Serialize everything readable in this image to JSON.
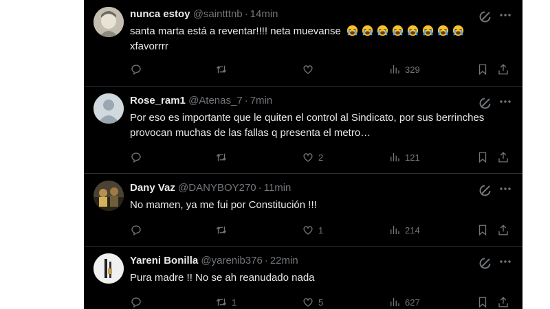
{
  "tweets": [
    {
      "name": "nunca estoy",
      "handle": "@saintttnb",
      "separator": "·",
      "time": "14min",
      "text": "santa marta está a reventar!!!! neta muevanse",
      "text2": "xfavorrrr",
      "emoji": "loudly-crying-face",
      "emoji_count": 8,
      "replies": "",
      "retweets": "",
      "likes": "",
      "views": "329"
    },
    {
      "name": "Rose_ram1",
      "handle": "@Atenas_7",
      "separator": "·",
      "time": "7min",
      "text": "Por eso es importante que le quiten el control al Sindicato, por sus berrinches provocan muchas de las fallas q presenta el metro…",
      "replies": "",
      "retweets": "",
      "likes": "2",
      "views": "121"
    },
    {
      "name": "Dany Vaz",
      "handle": "@DANYBOY270",
      "separator": "·",
      "time": "11min",
      "text": "No mamen, ya me fui por Constitución !!!",
      "replies": "",
      "retweets": "",
      "likes": "1",
      "views": "214"
    },
    {
      "name": "Yareni Bonilla",
      "handle": "@yarenib376",
      "separator": "·",
      "time": "22min",
      "text": "Pura madre !! No se ah reanudado nada",
      "replies": "",
      "retweets": "1",
      "likes": "5",
      "views": "627"
    }
  ],
  "colors": {
    "background": "#000000",
    "text": "#e7e9ea",
    "muted": "#71767b",
    "divider": "#2f3336"
  },
  "icons": [
    "reply-icon",
    "retweet-icon",
    "like-icon",
    "views-icon",
    "bookmark-icon",
    "share-icon",
    "grok-icon",
    "more-icon"
  ]
}
